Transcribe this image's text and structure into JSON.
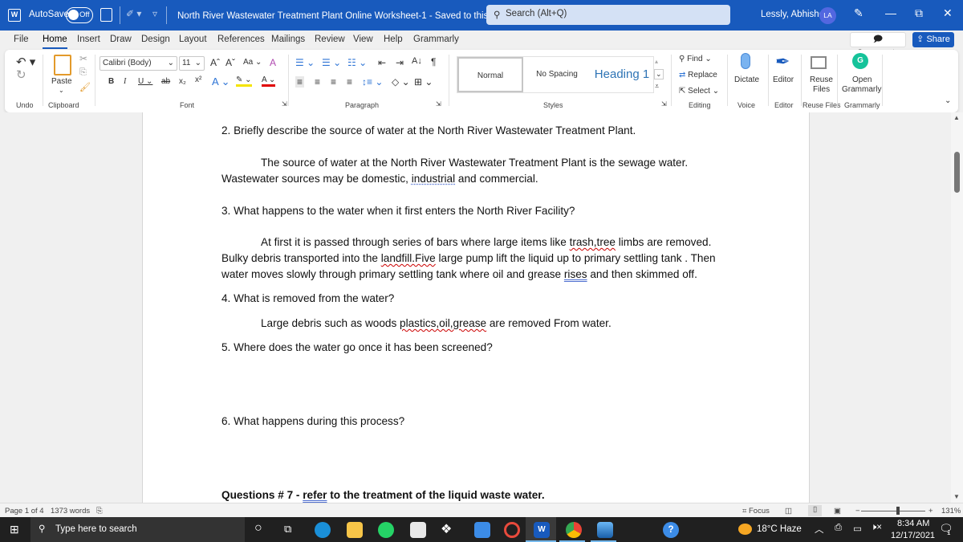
{
  "titlebar": {
    "app_icon": "word-icon",
    "autosave_label": "AutoSave",
    "autosave_state": "Off",
    "doc_title": "North River Wastewater Treatment Plant Online Worksheet-1  -  Saved to this PC  ▾",
    "search_placeholder": "Search (Alt+Q)",
    "user_name": "Lessly, Abhishek",
    "user_initials": "LA",
    "minimize": "—",
    "restore": "⧉",
    "close": "✕"
  },
  "menubar": {
    "tabs": [
      "File",
      "Home",
      "Insert",
      "Draw",
      "Design",
      "Layout",
      "References",
      "Mailings",
      "Review",
      "View",
      "Help",
      "Grammarly"
    ],
    "active": "Home",
    "comments_label": "Comments",
    "share_label": "Share"
  },
  "ribbon": {
    "undo_label": "Undo",
    "clipboard": {
      "paste_label": "Paste",
      "group_label": "Clipboard"
    },
    "font": {
      "family": "Calibri (Body)",
      "size": "11",
      "group_label": "Font",
      "case_label": "Aa"
    },
    "paragraph": {
      "group_label": "Paragraph"
    },
    "styles": {
      "items": [
        "Normal",
        "No Spacing",
        "Heading 1"
      ],
      "group_label": "Styles"
    },
    "editing": {
      "find": "Find",
      "replace": "Replace",
      "select": "Select",
      "group_label": "Editing"
    },
    "voice": {
      "dictate": "Dictate",
      "group_label": "Voice"
    },
    "editor": {
      "label": "Editor",
      "group_label": "Editor"
    },
    "reuse": {
      "label_line1": "Reuse",
      "label_line2": "Files",
      "group_label": "Reuse Files"
    },
    "grammarly": {
      "label_line1": "Open",
      "label_line2": "Grammarly",
      "group_label": "Grammarly"
    }
  },
  "document": {
    "q2": "2.  Briefly describe the source of water at the North River Wastewater Treatment Plant.",
    "a2_line1": "The source of water at the North River Wastewater Treatment Plant is the sewage water.",
    "a2_line2_pre": "Wastewater sources may be domestic, ",
    "a2_line2_flag": "industrial",
    "a2_line2_post": " and commercial.",
    "q3": "3.  What happens to the water when it first enters the North River Facility?",
    "a3_line1_pre": "At first it is passed through series of bars where large items like ",
    "a3_line1_flag": "trash,tree",
    "a3_line1_post": " limbs are removed.",
    "a3_line2_pre": "Bulky debris transported into the ",
    "a3_line2_flag": "landfill.Five",
    "a3_line2_post": " large pump lift the liquid up to primary settling tank . Then",
    "a3_line3_pre": "water moves slowly through primary settling tank where oil and grease ",
    "a3_line3_flag": "rises",
    "a3_line3_post": " and then skimmed off.",
    "q4": "4.  What is removed from the water?",
    "a4_pre": "Large debris such as woods ",
    "a4_flag": "plastics,oil,grease",
    "a4_post": " are removed From water.",
    "q5": "5. Where does the water go once it has been screened?",
    "q6": "6.  What happens during this process?",
    "q7_pre": "Questions # 7 -  ",
    "q7_flag": "refer",
    "q7_post": " to the treatment of the liquid waste water."
  },
  "statusbar": {
    "page": "Page 1 of 4",
    "words": "1373 words",
    "focus": "Focus",
    "zoom_pct": "131%",
    "zoom_value": 131
  },
  "taskbar": {
    "search_placeholder": "Type here to search",
    "weather": "18°C  Haze",
    "time": "8:34 AM",
    "date": "12/17/2021",
    "notifications": "1",
    "apps": [
      "cortana",
      "task-view",
      "edge",
      "file-explorer",
      "whatsapp",
      "store",
      "dropbox",
      "app-blue",
      "record",
      "word",
      "chrome",
      "photos",
      "help"
    ]
  }
}
